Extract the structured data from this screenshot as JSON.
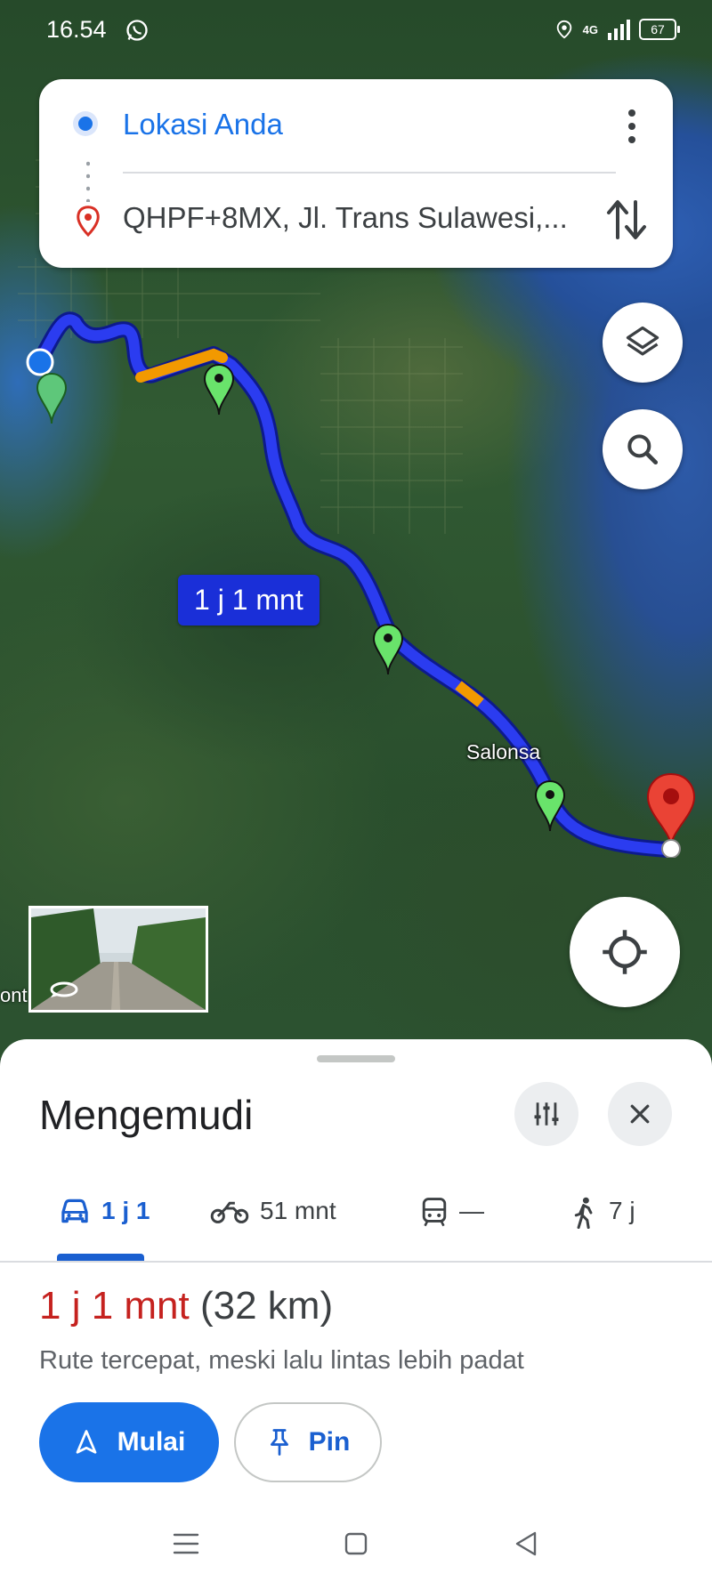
{
  "status_bar": {
    "time": "16.54",
    "network": "4G",
    "battery": "67",
    "icons": [
      "whatsapp-icon",
      "location-icon",
      "signal-icon",
      "battery-icon"
    ]
  },
  "directions": {
    "origin": "Lokasi Anda",
    "destination": "QHPF+8MX, Jl. Trans Sulawesi,..."
  },
  "map": {
    "duration_label": "1 j 1 mnt",
    "place_label": "Salonsa",
    "edge_label": "ont",
    "route_color": "#1a2fd8",
    "traffic_color": "#f29900"
  },
  "sheet": {
    "title": "Mengemudi",
    "modes": [
      {
        "icon": "car-icon",
        "label": "1 j 1",
        "active": true
      },
      {
        "icon": "motorcycle-icon",
        "label": "51 mnt",
        "active": false
      },
      {
        "icon": "transit-icon",
        "label": "—",
        "active": false
      },
      {
        "icon": "walk-icon",
        "label": "7 j",
        "active": false
      }
    ],
    "route_time": "1 j 1 mnt",
    "route_distance": "(32 km)",
    "route_note": "Rute tercepat, meski lalu lintas lebih padat",
    "start_label": "Mulai",
    "pin_label": "Pin"
  },
  "colors": {
    "accent": "#1a73e8",
    "time_red": "#c5221f"
  }
}
